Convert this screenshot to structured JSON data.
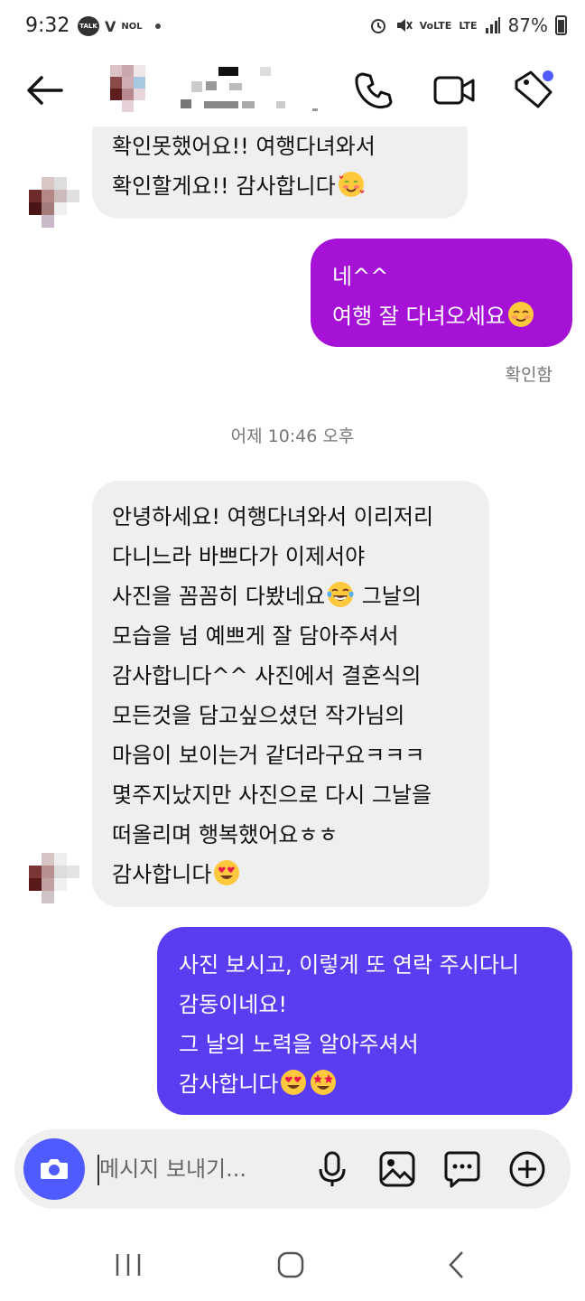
{
  "status_bar": {
    "time": "9:32",
    "talk": "TALK",
    "v_label": "V",
    "nol": "NOL",
    "volte": "VoLTE",
    "lte": "LTE",
    "battery": "87%"
  },
  "header": {
    "icons": [
      "back-arrow-icon",
      "phone-icon",
      "video-camera-icon",
      "tag-icon"
    ],
    "notification_dot_color": "#4f5bff"
  },
  "messages": [
    {
      "direction": "in",
      "lines": [
        "확인못했어요!! 여행다녀와서",
        "확인할게요!! 감사합니다"
      ],
      "trailing_emoji": "smiling-face-with-hearts"
    },
    {
      "direction": "out",
      "color": "#a611d6",
      "lines": [
        "네^^",
        "여행 잘 다녀오세요"
      ],
      "trailing_emoji": "smiling-face"
    },
    {
      "direction": "in",
      "lines": [
        "안녕하세요! 여행다녀와서 이리저리",
        "다니느라 바쁘다가 이제서야",
        "사진을 꼼꼼히 다봤네요",
        "모습을 넘 예쁘게 잘 담아주셔서",
        "감사합니다^^ 사진에서 결혼식의",
        "모든것을 담고싶으셨던 작가님의",
        "마음이 보이는거 같더라구요ㅋㅋㅋ",
        "몇주지났지만 사진으로 다시 그날을",
        "떠올리며 행복했어요ㅎㅎ",
        "감사합니다"
      ],
      "inline_emoji_line_3_text": "그날의",
      "trailing_emoji": "heart-eyes"
    },
    {
      "direction": "out",
      "color": "#5a3df0",
      "lines": [
        "사진 보시고, 이렇게 또 연락 주시다니",
        "감동이네요!",
        "그 날의 노력을 알아주셔서",
        "감사합니다"
      ],
      "trailing_emoji": "heart-eyes, star-struck"
    }
  ],
  "seen_label": "확인함",
  "timestamp": "어제 10:46 오후",
  "composer": {
    "placeholder": "메시지 보내기...",
    "icons": [
      "camera-icon",
      "microphone-icon",
      "gallery-icon",
      "sticker-chat-icon",
      "add-icon"
    ],
    "camera_color": "#4f5bff"
  },
  "nav_bar": {
    "icons": [
      "recent-apps-icon",
      "home-icon",
      "back-icon"
    ]
  }
}
